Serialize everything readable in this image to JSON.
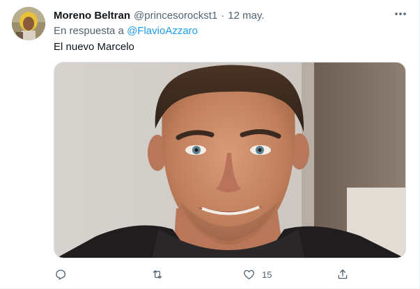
{
  "tweet": {
    "display_name": "Moreno Beltran",
    "handle": "@princesorockst1",
    "separator": "·",
    "date": "12 may.",
    "reply_prefix": "En respuesta a",
    "reply_to": "@FlavioAzzaro",
    "text": "El nuevo Marcelo",
    "media_alt": "Photo of a smiling man with short brown hair",
    "actions": {
      "reply_count": "",
      "retweet_count": "",
      "like_count": "15",
      "share_count": ""
    }
  },
  "icons": {
    "more": "more-icon",
    "reply": "reply-icon",
    "retweet": "retweet-icon",
    "like": "like-icon",
    "share": "share-icon"
  },
  "colors": {
    "text": "#0f1419",
    "secondary": "#536471",
    "link": "#1d9bf0"
  }
}
